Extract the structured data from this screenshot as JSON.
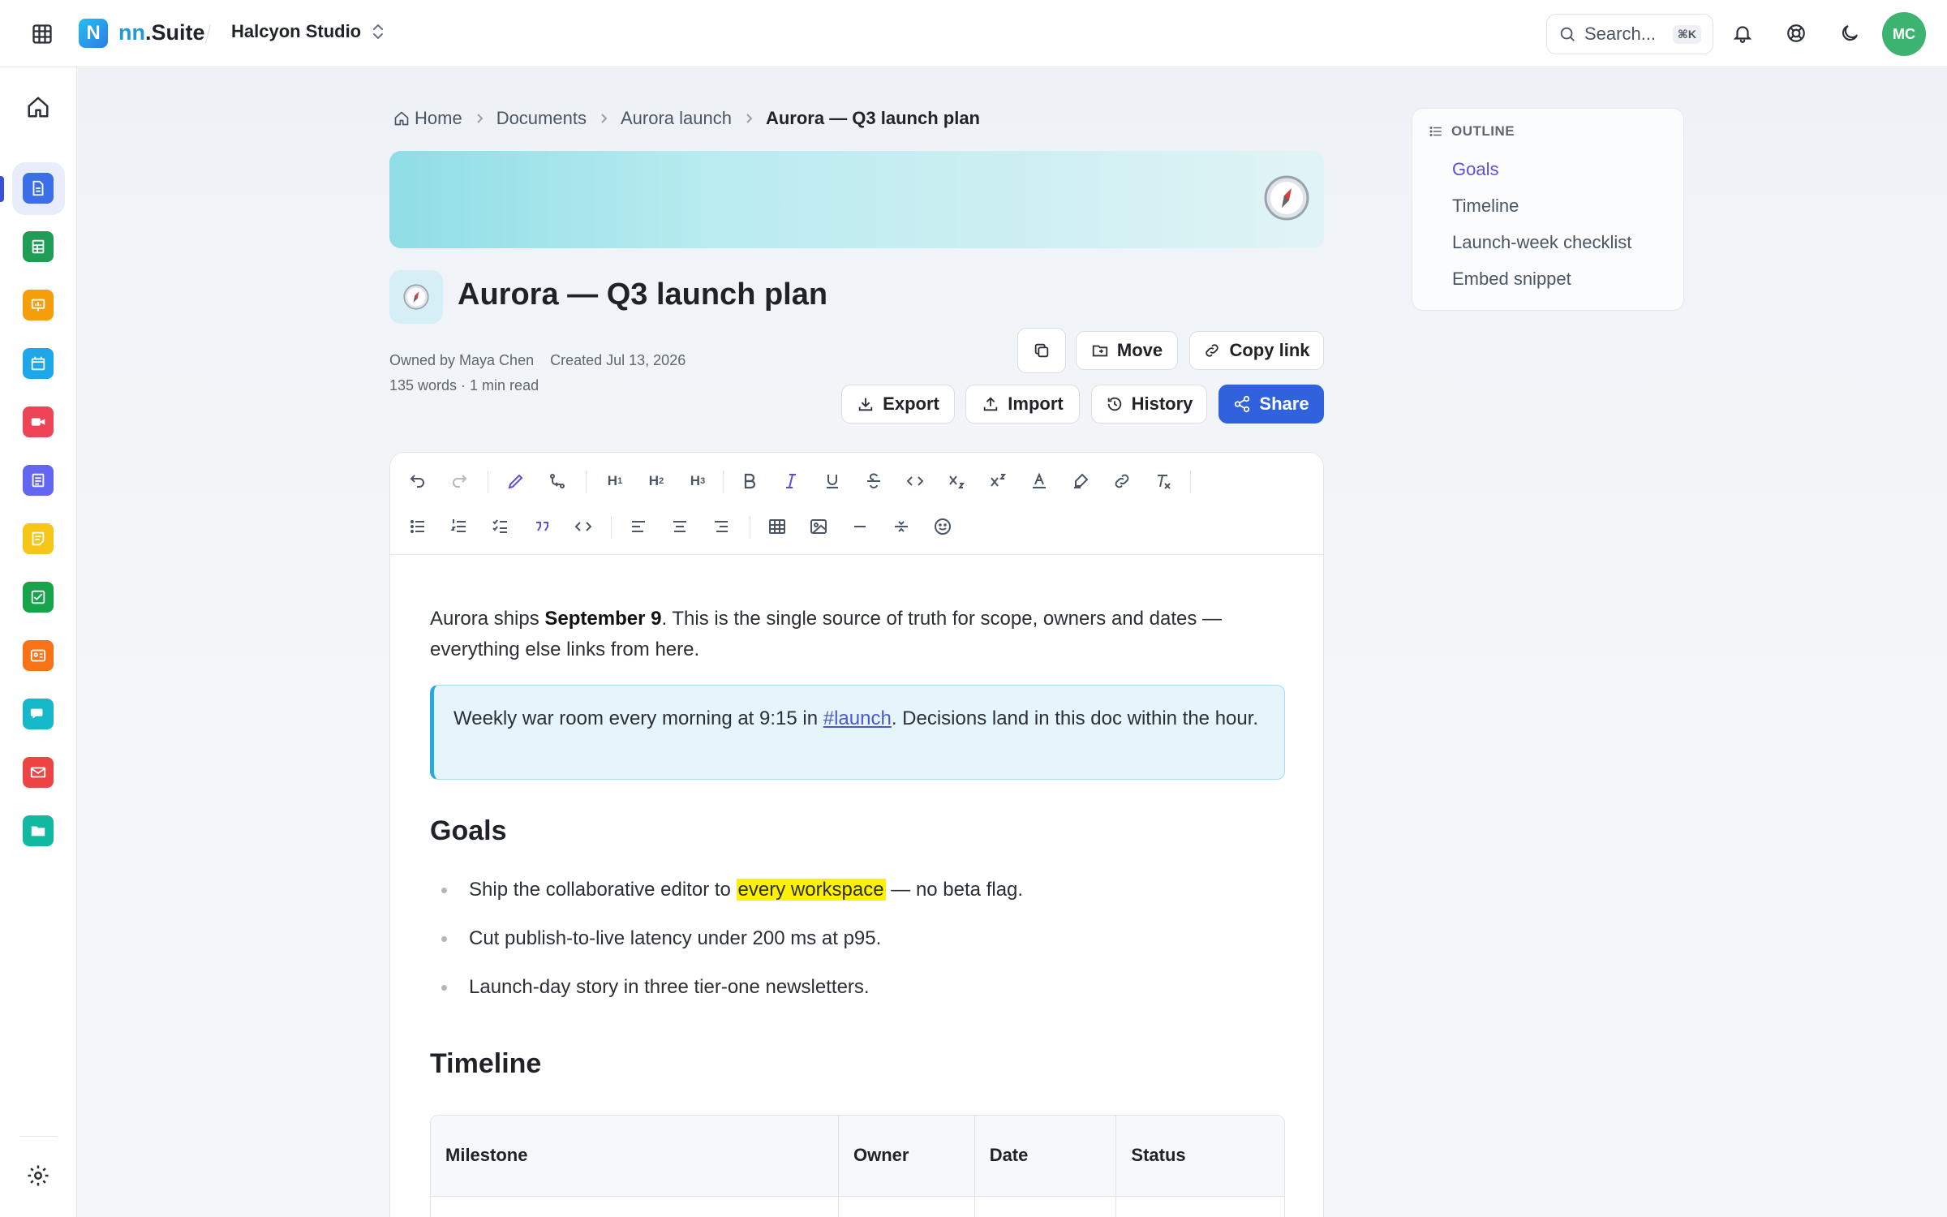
{
  "app": {
    "brand_prefix": "nn",
    "brand_suffix": ".Suite",
    "logo_letter": "N",
    "workspace": "Halcyon Studio"
  },
  "topbar": {
    "search_placeholder": "Search...",
    "search_shortcut": "⌘K",
    "avatar_initials": "MC",
    "icons": [
      "apps-grid-icon",
      "search-icon",
      "bell-icon",
      "help-lifebuoy-icon",
      "moon-icon"
    ]
  },
  "rail": {
    "apps": [
      {
        "name": "docs",
        "color": "#3b6fe8"
      },
      {
        "name": "sheets",
        "color": "#1f9d57"
      },
      {
        "name": "slides",
        "color": "#f59e0b"
      },
      {
        "name": "calendar",
        "color": "#1ea7e8"
      },
      {
        "name": "meet",
        "color": "#ef4458"
      },
      {
        "name": "forms",
        "color": "#6366f1"
      },
      {
        "name": "notes",
        "color": "#f5c518"
      },
      {
        "name": "tasks",
        "color": "#16a34a"
      },
      {
        "name": "contacts",
        "color": "#f97316"
      },
      {
        "name": "chat",
        "color": "#14b8c9"
      },
      {
        "name": "mail",
        "color": "#ef4444"
      },
      {
        "name": "files",
        "color": "#10b9a0"
      }
    ]
  },
  "breadcrumb": {
    "items": [
      "Home",
      "Documents",
      "Aurora launch",
      "Aurora — Q3 launch plan"
    ]
  },
  "document": {
    "title": "Aurora — Q3 launch plan",
    "owner": "Owned by Maya Chen",
    "created": "Created Jul 13, 2026",
    "stats": "135 words · 1 min read"
  },
  "actions": {
    "move": "Move",
    "copy_link": "Copy link",
    "export": "Export",
    "import": "Import",
    "history": "History",
    "share": "Share"
  },
  "toolbar": {
    "h1": "H",
    "h2": "H",
    "h3": "H",
    "h1_sub": "1",
    "h2_sub": "2",
    "h3_sub": "3"
  },
  "content": {
    "intro_before": "Aurora ships ",
    "intro_bold": "September 9",
    "intro_after": ". This is the single source of truth for scope, owners and dates — everything else links from here.",
    "callout_before": "Weekly war room every morning at 9:15 in ",
    "callout_mention": "#launch",
    "callout_after": ". Decisions land in this doc within the hour.",
    "goals_heading": "Goals",
    "goal1_before": "Ship the collaborative editor to ",
    "goal1_highlight": "every workspace",
    "goal1_after": " — no beta flag.",
    "goal2": "Cut publish-to-live latency under 200 ms at p95.",
    "goal3": "Launch-day story in three tier-one newsletters.",
    "timeline_heading": "Timeline",
    "table_headers": [
      "Milestone",
      "Owner",
      "Date",
      "Status"
    ]
  },
  "outline": {
    "heading": "OUTLINE",
    "items": [
      "Goals",
      "Timeline",
      "Launch-week checklist",
      "Embed snippet"
    ]
  }
}
